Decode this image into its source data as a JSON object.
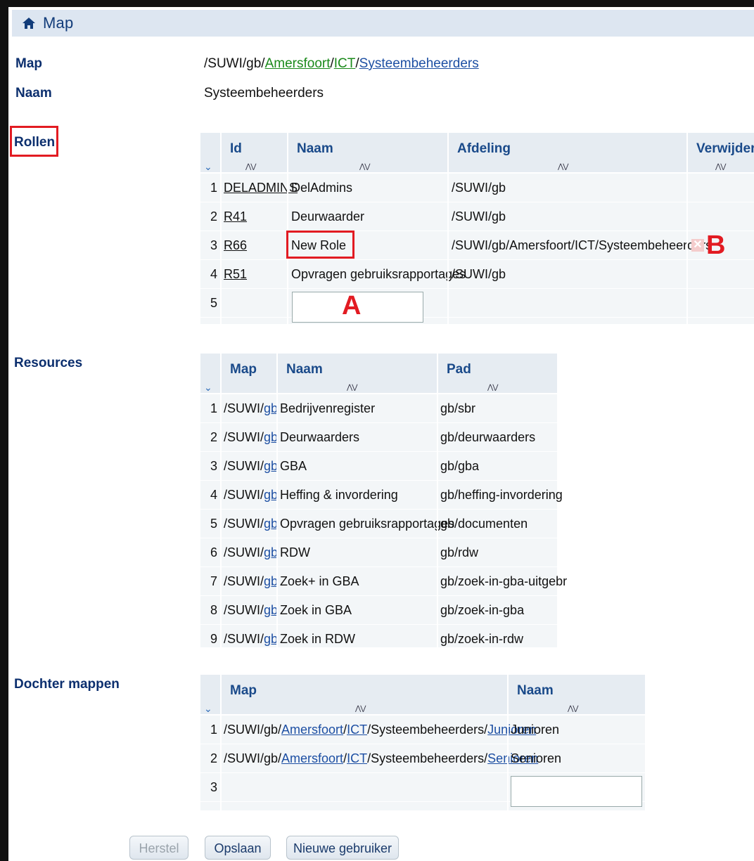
{
  "title": "Map",
  "fields": {
    "map_label": "Map",
    "map_path": {
      "prefix": "/SUWI/gb/",
      "link1": "Amersfoort",
      "sep1": "/",
      "link2": "ICT",
      "sep2": "/",
      "link3": "Systeembeheerders"
    },
    "naam_label": "Naam",
    "naam_value": "Systeembeheerders",
    "rollen_label": "Rollen",
    "resources_label": "Resources",
    "dochter_label": "Dochter mappen"
  },
  "rollen": {
    "headers": [
      "Id",
      "Naam",
      "Afdeling",
      "Verwijder"
    ],
    "rows": [
      {
        "num": "1",
        "id": "DELADMINS",
        "naam": "DelAdmins",
        "afdeling": "/SUWI/gb"
      },
      {
        "num": "2",
        "id": "R41",
        "naam": "Deurwaarder",
        "afdeling": "/SUWI/gb"
      },
      {
        "num": "3",
        "id": "R66",
        "naam": "New Role",
        "afdeling": "/SUWI/gb/Amersfoort/ICT/Systeembeheerders"
      },
      {
        "num": "4",
        "id": "R51",
        "naam": "Opvragen gebruiksrapportages",
        "afdeling": "/SUWI/gb"
      },
      {
        "num": "5"
      }
    ]
  },
  "resources": {
    "headers": [
      "Map",
      "Naam",
      "Pad"
    ],
    "rows": [
      {
        "num": "1",
        "map_prefix": "/SUWI/",
        "map_link": "gb",
        "naam": "Bedrijvenregister",
        "pad": "gb/sbr"
      },
      {
        "num": "2",
        "map_prefix": "/SUWI/",
        "map_link": "gb",
        "naam": "Deurwaarders",
        "pad": "gb/deurwaarders"
      },
      {
        "num": "3",
        "map_prefix": "/SUWI/",
        "map_link": "gb",
        "naam": "GBA",
        "pad": "gb/gba"
      },
      {
        "num": "4",
        "map_prefix": "/SUWI/",
        "map_link": "gb",
        "naam": "Heffing & invordering",
        "pad": "gb/heffing-invordering"
      },
      {
        "num": "5",
        "map_prefix": "/SUWI/",
        "map_link": "gb",
        "naam": "Opvragen gebruiksrapportages",
        "pad": "gb/documenten"
      },
      {
        "num": "6",
        "map_prefix": "/SUWI/",
        "map_link": "gb",
        "naam": "RDW",
        "pad": "gb/rdw"
      },
      {
        "num": "7",
        "map_prefix": "/SUWI/",
        "map_link": "gb",
        "naam": "Zoek+ in GBA",
        "pad": "gb/zoek-in-gba-uitgebr"
      },
      {
        "num": "8",
        "map_prefix": "/SUWI/",
        "map_link": "gb",
        "naam": "Zoek in GBA",
        "pad": "gb/zoek-in-gba"
      },
      {
        "num": "9",
        "map_prefix": "/SUWI/",
        "map_link": "gb",
        "naam": "Zoek in RDW",
        "pad": "gb/zoek-in-rdw"
      }
    ]
  },
  "dochter": {
    "headers": [
      "Map",
      "Naam"
    ],
    "rows": [
      {
        "num": "1",
        "prefix": "/SUWI/gb/",
        "l1": "Amersfoort",
        "l2": "ICT",
        "mid": "/Systeembeheerders/",
        "l3": "Junioren",
        "naam": "Junioren"
      },
      {
        "num": "2",
        "prefix": "/SUWI/gb/",
        "l1": "Amersfoort",
        "l2": "ICT",
        "mid": "/Systeembeheerders/",
        "l3": "Senioren",
        "naam": "Senioren"
      },
      {
        "num": "3"
      }
    ]
  },
  "annotations": {
    "a": "A",
    "b": "B"
  },
  "buttons": {
    "herstel": "Herstel",
    "opslaan": "Opslaan",
    "nieuwe": "Nieuwe gebruiker"
  },
  "colors": {
    "accent": "#0c2f6e",
    "link": "#1d4fa3",
    "highlight": "#e21b22"
  }
}
